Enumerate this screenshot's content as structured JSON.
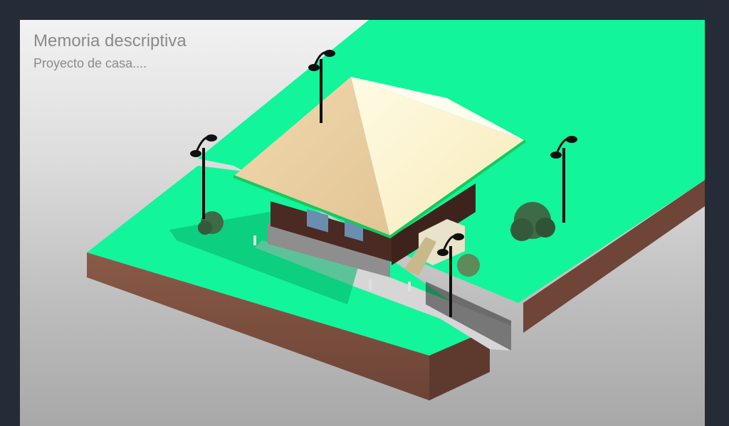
{
  "slide": {
    "title": "Memoria descriptiva",
    "subtitle": "Proyecto de casa...."
  },
  "colors": {
    "frame": "#252c38",
    "lawn": "#12f59a",
    "lawn_shade": "#0ccf82",
    "soil_front": "#7b4f3f",
    "soil_side": "#6a4235",
    "roof_light": "#fdf3d0",
    "roof_dark": "#e8cfa3",
    "roof_trim": "#17c85c",
    "wall": "#4a2a22",
    "base": "#9a9a9a",
    "lamp": "#111111",
    "tree": "#3d6b45"
  }
}
